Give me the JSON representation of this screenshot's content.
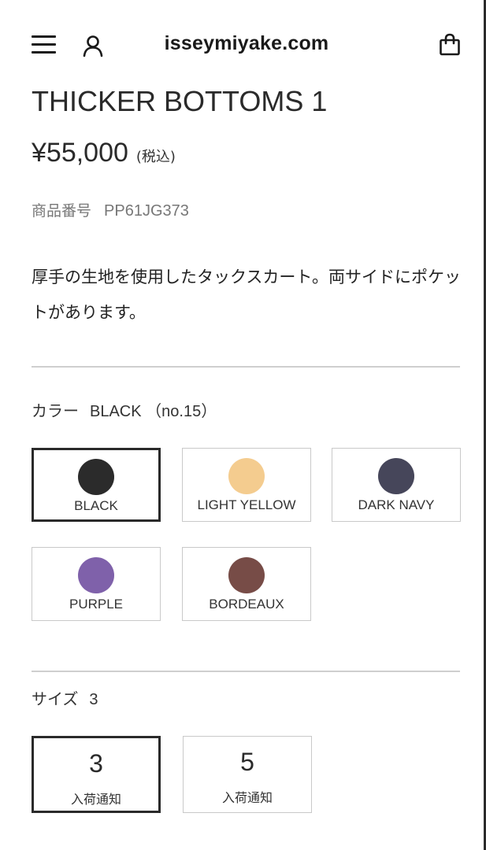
{
  "header": {
    "site_title": "isseymiyake.com",
    "menu_icon": "hamburger-menu-icon",
    "account_icon": "user-icon",
    "cart_icon": "shopping-bag-icon"
  },
  "product": {
    "title": "THICKER BOTTOMS 1",
    "price": "¥55,000",
    "tax_note": "(税込)",
    "sku_label": "商品番号",
    "sku_value": "PP61JG373",
    "description": "厚手の生地を使用したタックスカート。両サイドにポケットがあります。"
  },
  "color": {
    "label": "カラー",
    "selected_value": "BLACK （no.15）",
    "options": [
      {
        "name": "BLACK",
        "color": "#2b2b2b",
        "selected": true
      },
      {
        "name": "LIGHT YELLOW",
        "color": "#f4cc8f",
        "selected": false
      },
      {
        "name": "DARK NAVY",
        "color": "#46465a",
        "selected": false
      },
      {
        "name": "PURPLE",
        "color": "#7f61aa",
        "selected": false
      },
      {
        "name": "BORDEAUX",
        "color": "#774c47",
        "selected": false
      }
    ]
  },
  "size": {
    "label": "サイズ",
    "selected_value": "3",
    "options": [
      {
        "name": "3",
        "note": "入荷通知",
        "selected": true
      },
      {
        "name": "5",
        "note": "入荷通知",
        "selected": false
      }
    ]
  }
}
